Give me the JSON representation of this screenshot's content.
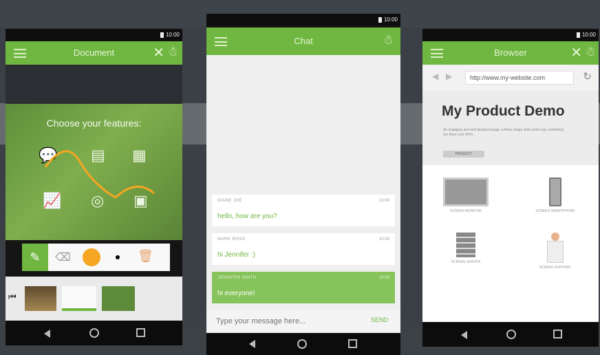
{
  "colors": {
    "accent": "#6fb740",
    "accent_light": "#86c35a",
    "marker": "#f5a623"
  },
  "document_phone": {
    "status_time": "10:00",
    "title": "Document",
    "features_title": "Choose your features:",
    "icons": [
      "chat-icon",
      "document-icon",
      "calendar-icon",
      "chart-icon",
      "compass-icon",
      "image-icon"
    ],
    "tools": [
      "pen-icon",
      "eraser-icon",
      "color-swatch",
      "brush-size-dot",
      "trash-icon"
    ]
  },
  "chat_phone": {
    "status_time": "10:00",
    "title": "Chat",
    "messages": [
      {
        "name": "DIANE JOE",
        "time": "10:00",
        "text": "hello, how are you?"
      },
      {
        "name": "MARK ROSS",
        "time": "10:00",
        "text": "hi Jennifer :)"
      },
      {
        "name": "JENNIFER SMITH",
        "time": "10:00",
        "text": "hi everyone!"
      }
    ],
    "compose_placeholder": "Type your message here...",
    "send_label": "SEND"
  },
  "browser_phone": {
    "status_time": "10:00",
    "title": "Browser",
    "url": "http://www.my-website.com",
    "heading": "My Product Demo",
    "blurb": "An engaging and well designed page, a three image slide at the top, containing our three core KPIs.",
    "cta_label": "PRODUCT",
    "products": [
      {
        "caption": "SCREEN MONITOR"
      },
      {
        "caption": "SCREEN SMARTPHONE"
      },
      {
        "caption": "SCREEN SERVER"
      },
      {
        "caption": "SCREEN SUPPORT"
      }
    ]
  }
}
